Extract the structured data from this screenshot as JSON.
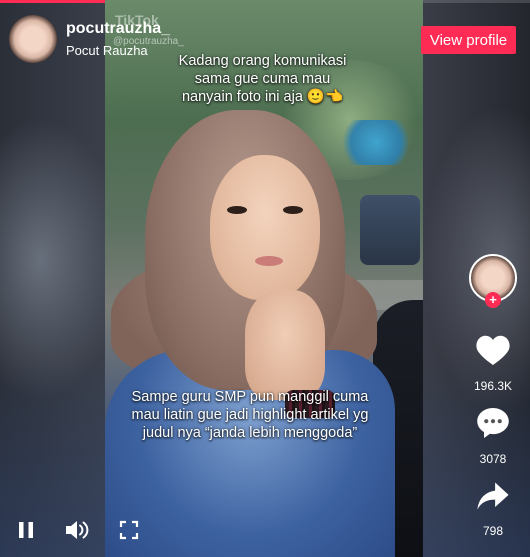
{
  "author": {
    "username": "pocutrauzha_",
    "nickname": "Pocut Rauzha"
  },
  "video": {
    "watermark_brand": "TikTok",
    "watermark_handle": "@pocutrauzha_",
    "caption_top": "Kadang orang komunikasi sama gue cuma mau nanyain foto ini aja 🙂👈",
    "caption_bottom": "Sampe guru SMP pun manggil cuma mau liatin gue jadi highlight artikel yg judul nya “janda lebih menggoda”",
    "progress": 0.27
  },
  "header": {
    "view_profile_label": "View profile"
  },
  "actions": {
    "follow_symbol": "+",
    "likes": "196.3K",
    "comments": "3078",
    "shares": "798"
  },
  "controls": {
    "pause_icon": "pause-icon",
    "volume_icon": "volume-icon",
    "fullscreen_icon": "fullscreen-icon"
  },
  "colors": {
    "accent": "#fe2c55"
  }
}
